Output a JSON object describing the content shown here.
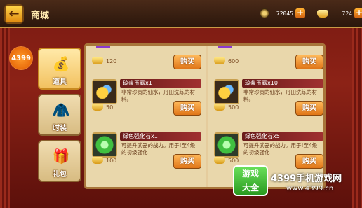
{
  "header": {
    "back_icon": "arrow-left-icon",
    "title": "商城"
  },
  "currencies": [
    {
      "icon": "coin-icon",
      "value": "72045"
    },
    {
      "icon": "gold-ingot-icon",
      "value": "724"
    }
  ],
  "side_logo": "4399",
  "tabs": [
    {
      "label": "道具",
      "icon": "treasure-bag-icon",
      "active": true
    },
    {
      "label": "时装",
      "icon": "outfit-icon",
      "active": false
    },
    {
      "label": "礼包",
      "icon": "gift-box-icon",
      "active": false
    }
  ],
  "items": [
    {
      "name": "",
      "desc": "",
      "price": "120",
      "buy": "购买"
    },
    {
      "name": "",
      "desc": "",
      "price": "600",
      "buy": "购买"
    },
    {
      "name": "琼浆玉露x1",
      "desc": "非常珍贵的仙水，丹田洗练的材料。",
      "price": "50",
      "buy": "购买",
      "icon": "jade-dew-icon"
    },
    {
      "name": "琼浆玉露x10",
      "desc": "非常珍贵的仙水，丹田洗练的材料。",
      "price": "500",
      "buy": "购买",
      "icon": "jade-dew-icon"
    },
    {
      "name": "绿色强化石x1",
      "desc": "可提升武器的战力。用于!至4级的初级强化",
      "price": "100",
      "buy": "购买",
      "icon": "green-stone-icon"
    },
    {
      "name": "绿色强化石x5",
      "desc": "可提升武器的战力。用于!至4级的初级强化",
      "price": "500",
      "buy": "购买",
      "icon": "green-stone-icon"
    }
  ],
  "watermark": {
    "logo_top": "游戏",
    "logo_bottom": "大全",
    "text": "4399手机游戏网",
    "url": "www.4399.cn"
  }
}
